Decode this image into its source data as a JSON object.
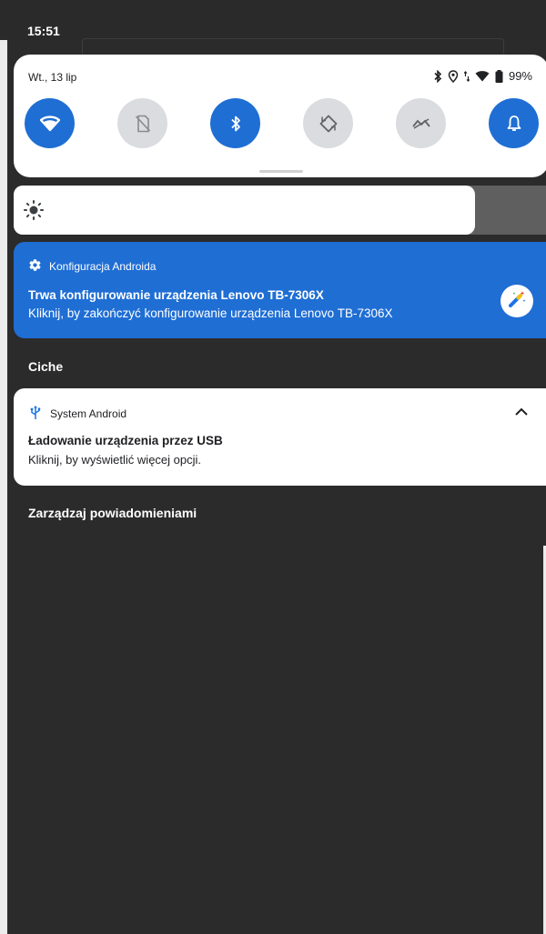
{
  "status_bar": {
    "time": "15:51"
  },
  "quick_settings": {
    "date": "Wt., 13 lip",
    "battery": "99%",
    "tiles": [
      {
        "name": "wifi",
        "state": "on",
        "icon": "wifi-icon"
      },
      {
        "name": "sim",
        "state": "off",
        "icon": "no-sim-icon"
      },
      {
        "name": "bluetooth",
        "state": "on",
        "icon": "bluetooth-icon"
      },
      {
        "name": "auto-rotate",
        "state": "off",
        "icon": "rotate-icon"
      },
      {
        "name": "data-saver",
        "state": "off",
        "icon": "data-saver-icon"
      },
      {
        "name": "notifications",
        "state": "on",
        "icon": "bell-icon"
      }
    ]
  },
  "brightness": {
    "level": 0.86,
    "icon": "brightness-icon"
  },
  "notifications": [
    {
      "app": "Konfiguracja Androida",
      "title": "Trwa konfigurowanie urządzenia Lenovo TB-7306X",
      "text": "Kliknij, by zakończyć konfigurowanie urządzenia Lenovo TB-7306X",
      "color": "#1f6ed4"
    },
    {
      "app": "System Android",
      "title": "Ładowanie urządzenia przez USB",
      "text": "Kliknij, by wyświetlić więcej opcji."
    }
  ],
  "sections": {
    "silent": "Ciche",
    "manage": "Zarządzaj powiadomieniami"
  },
  "colors": {
    "accent": "#1f6ed4",
    "tile_off": "#dadce0",
    "background": "#2b2b2b"
  }
}
